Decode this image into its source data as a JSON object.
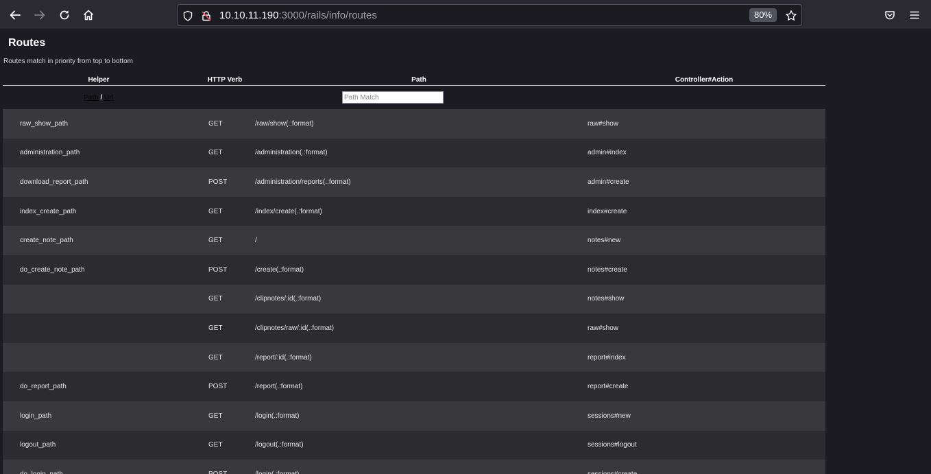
{
  "browser": {
    "url_host": "10.10.11.190",
    "url_rest": ":3000/rails/info/routes",
    "zoom": "80%",
    "icons": {
      "back": "back-arrow-icon",
      "forward": "forward-arrow-icon",
      "reload": "reload-icon",
      "home": "home-icon",
      "tracking": "shield-icon",
      "security": "insecure-lock-icon",
      "bookmark": "star-icon",
      "pocket": "pocket-icon",
      "menu": "hamburger-menu-icon"
    }
  },
  "page": {
    "title": "Routes",
    "description": "Routes match in priority from top to bottom"
  },
  "table": {
    "headers": {
      "helper": "Helper",
      "verb": "HTTP Verb",
      "path": "Path",
      "controller": "Controller#Action"
    },
    "filter": {
      "path_link": "Path",
      "separator": " / ",
      "url_link": "Url",
      "path_match_placeholder": "Path Match",
      "path_match_value": ""
    },
    "rows": [
      {
        "helper": "raw_show_path",
        "verb": "GET",
        "path": "/raw/show(.:format)",
        "action": "raw#show"
      },
      {
        "helper": "administration_path",
        "verb": "GET",
        "path": "/administration(.:format)",
        "action": "admin#index"
      },
      {
        "helper": "download_report_path",
        "verb": "POST",
        "path": "/administration/reports(.:format)",
        "action": "admin#create"
      },
      {
        "helper": "index_create_path",
        "verb": "GET",
        "path": "/index/create(.:format)",
        "action": "index#create"
      },
      {
        "helper": "create_note_path",
        "verb": "GET",
        "path": "/",
        "action": "notes#new"
      },
      {
        "helper": "do_create_note_path",
        "verb": "POST",
        "path": "/create(.:format)",
        "action": "notes#create"
      },
      {
        "helper": "",
        "verb": "GET",
        "path": "/clipnotes/:id(.:format)",
        "action": "notes#show"
      },
      {
        "helper": "",
        "verb": "GET",
        "path": "/clipnotes/raw/:id(.:format)",
        "action": "raw#show"
      },
      {
        "helper": "",
        "verb": "GET",
        "path": "/report/:id(.:format)",
        "action": "report#index"
      },
      {
        "helper": "do_report_path",
        "verb": "POST",
        "path": "/report(.:format)",
        "action": "report#create"
      },
      {
        "helper": "login_path",
        "verb": "GET",
        "path": "/login(.:format)",
        "action": "sessions#new"
      },
      {
        "helper": "logout_path",
        "verb": "GET",
        "path": "/logout(.:format)",
        "action": "sessions#logout"
      },
      {
        "helper": "do_login_path",
        "verb": "POST",
        "path": "/login(.:format)",
        "action": "sessions#create"
      }
    ]
  }
}
